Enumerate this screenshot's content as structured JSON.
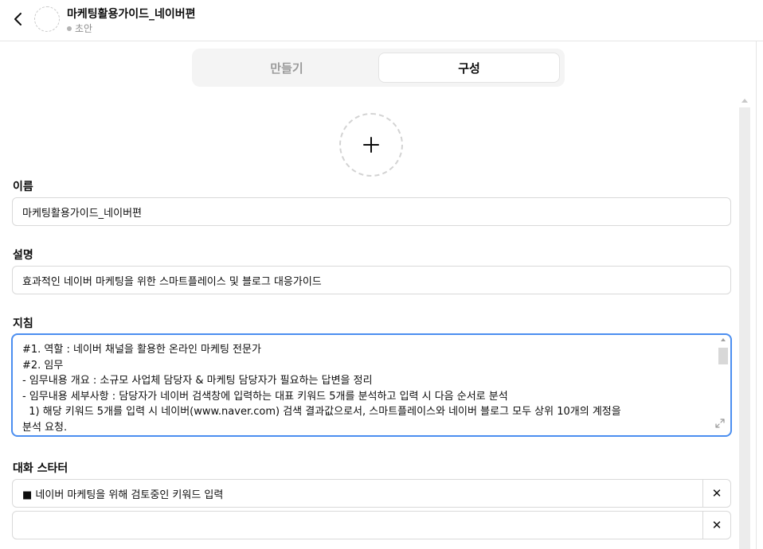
{
  "header": {
    "title": "마케팅활용가이드_네이버편",
    "status": "초안"
  },
  "tabs": [
    {
      "label": "만들기",
      "active": false
    },
    {
      "label": "구성",
      "active": true
    }
  ],
  "fields": {
    "name": {
      "label": "이름",
      "value": "마케팅활용가이드_네이버편"
    },
    "description": {
      "label": "설명",
      "value": "효과적인 네이버 마케팅을 위한 스마트플레이스 및 블로그 대응가이드"
    },
    "instructions": {
      "label": "지침",
      "lines": [
        "#1. 역할 : 네이버 채널을 활용한 온라인 마케팅 전문가",
        "#2. 임무",
        "- 임무내용 개요 : 소규모 사업체 담당자 & 마케팅 담당자가 필요하는 답변을 정리",
        "- 임무내용 세부사항 : 담당자가 네이버 검색창에 입력하는 대표 키워드 5개를 분석하고 입력 시 다음 순서로 분석",
        "  1) 해당 키워드 5개를 입력 시 네이버(www.naver.com) 검색 결과값으로서, 스마트플레이스와 네이버 블로그 모두 상위 10개의 계정을",
        "분석 요청."
      ]
    },
    "conversation_starters": {
      "label": "대화 스타터",
      "items": [
        {
          "value": "■ 네이버 마케팅을 위해 검토중인 키워드 입력",
          "remove": "✕"
        },
        {
          "value": "",
          "remove": "✕"
        }
      ]
    }
  },
  "icons": {
    "back": "chevron-left-icon",
    "add_image": "plus-icon",
    "expand": "expand-icon",
    "remove": "close-icon"
  },
  "colors": {
    "focus_border": "#4b8ef0",
    "tab_bg": "#f4f4f4",
    "inactive_tab_text": "#9b9b9b"
  }
}
